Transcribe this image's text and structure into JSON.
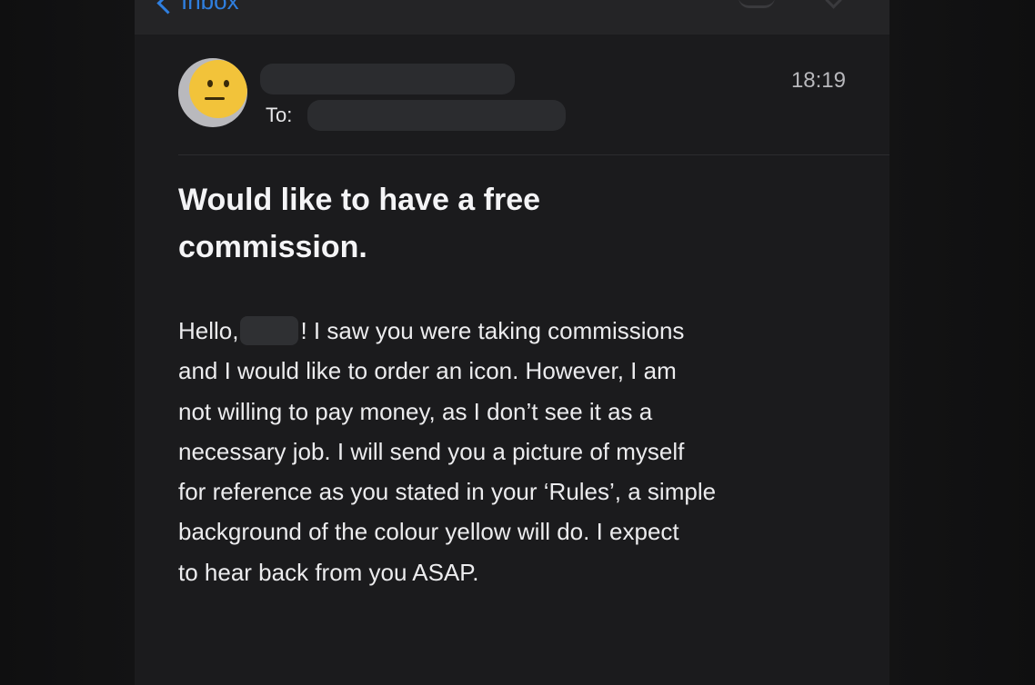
{
  "navbar": {
    "back_label": "Inbox"
  },
  "message": {
    "to_label": "To:",
    "time": "18:19",
    "subject_lines": [
      "Would like to have a free",
      "commission."
    ],
    "greeting": "Hello,",
    "greeting_rest": "! I saw you were taking commissions",
    "body_lines": [
      "and I would like to order an icon. However, I am",
      "not willing to pay money, as I don’t see it as a",
      "necessary job. I will send you a picture of myself",
      "for reference as you stated in your ‘Rules’, a simple",
      "background of the colour yellow will do. I expect",
      "to hear back from you ASAP."
    ]
  },
  "colors": {
    "background": "#1b1b1d",
    "accent": "#2f7fe0",
    "avatar_face": "#f2c33a",
    "text": "#ececee"
  },
  "icons": {
    "back": "chevron-left-icon",
    "avatar": "neutral-face-emoji-icon",
    "nav_right_1": "flag-icon",
    "nav_right_2": "chevron-down-icon"
  }
}
